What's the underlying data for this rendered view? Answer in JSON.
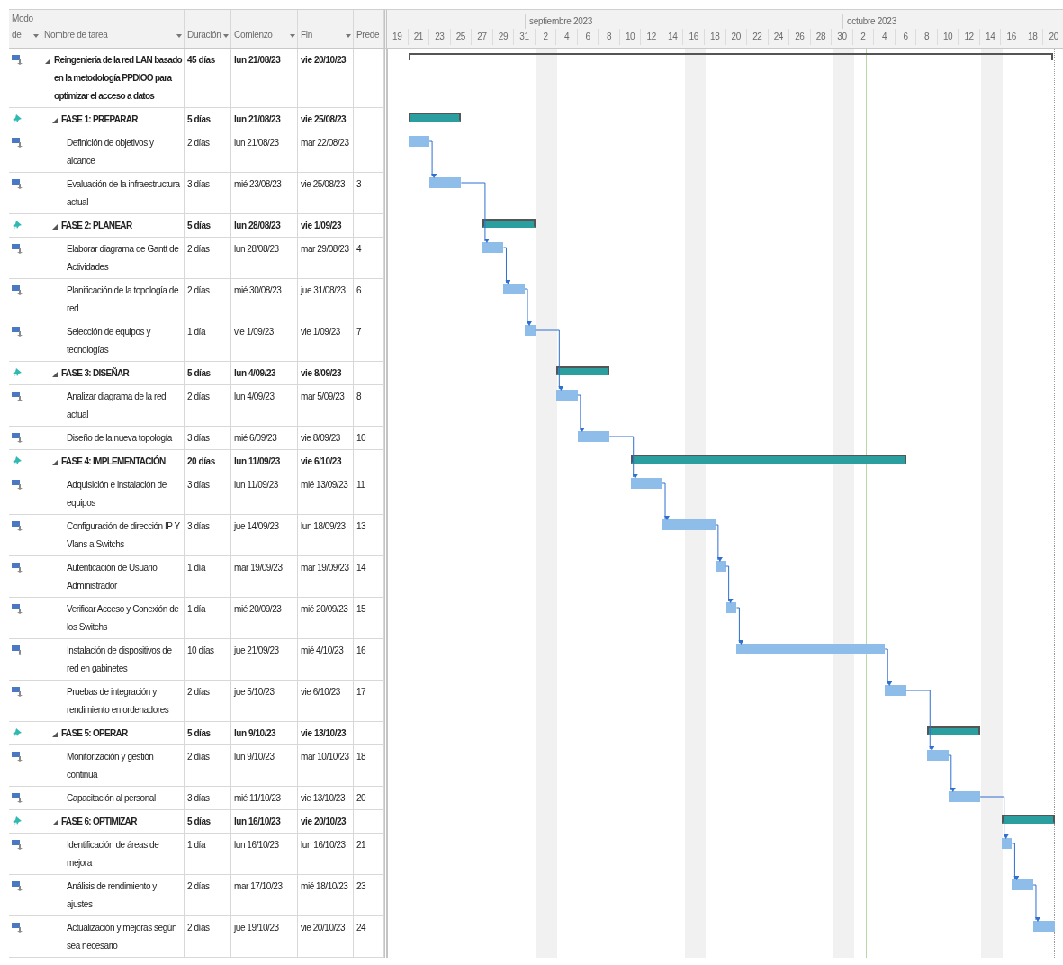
{
  "header": {
    "columns": [
      {
        "label": "Modo de",
        "filter": true
      },
      {
        "label": "Nombre de tarea",
        "filter": true
      },
      {
        "label": "Duración",
        "filter": true
      },
      {
        "label": "Comienzo",
        "filter": true
      },
      {
        "label": "Fin",
        "filter": true
      },
      {
        "label": "Prede",
        "filter": false
      }
    ]
  },
  "timeline": {
    "months": [
      "septiembre 2023",
      "octubre 2023"
    ],
    "days": [
      "19",
      "21",
      "23",
      "25",
      "27",
      "29",
      "31",
      "2",
      "4",
      "6",
      "8",
      "10",
      "12",
      "14",
      "16",
      "18",
      "20",
      "22",
      "24",
      "26",
      "28",
      "30",
      "2",
      "4",
      "6",
      "8",
      "10",
      "12",
      "14",
      "16",
      "18",
      "20"
    ]
  },
  "project": {
    "kind": "project",
    "name": "Reingeniería de la red LAN basado en la metodología PPDIOO para optimizar el acceso a datos",
    "duration": "45 días",
    "start": "lun 21/08/23",
    "end": "vie 20/10/23",
    "expanded": true,
    "children": [
      {
        "kind": "phase",
        "name": "FASE 1: PREPARAR",
        "duration": "5 días",
        "start": "lun 21/08/23",
        "end": "vie 25/08/23",
        "expanded": true,
        "children": [
          {
            "kind": "task",
            "name": "Definición de objetivos y alcance",
            "duration": "2 días",
            "start": "lun 21/08/23",
            "end": "mar 22/08/23"
          },
          {
            "kind": "task",
            "name": "Evaluación de la infraestructura actual",
            "duration": "3 días",
            "start": "mié 23/08/23",
            "end": "vie 25/08/23",
            "predecessor": "3"
          }
        ]
      },
      {
        "kind": "phase",
        "name": "FASE 2: PLANEAR",
        "duration": "5 días",
        "start": "lun 28/08/23",
        "end": "vie 1/09/23",
        "expanded": true,
        "children": [
          {
            "kind": "task",
            "name": "Elaborar diagrama de Gantt de Actividades",
            "duration": "2 días",
            "start": "lun 28/08/23",
            "end": "mar 29/08/23",
            "predecessor": "4"
          },
          {
            "kind": "task",
            "name": "Planificación de la topología de red",
            "duration": "2 días",
            "start": "mié 30/08/23",
            "end": "jue 31/08/23",
            "predecessor": "6"
          },
          {
            "kind": "task",
            "name": "Selección de equipos y tecnologías",
            "duration": "1 día",
            "start": "vie 1/09/23",
            "end": "vie 1/09/23",
            "predecessor": "7"
          }
        ]
      },
      {
        "kind": "phase",
        "name": "FASE 3: DISEÑAR",
        "duration": "5 días",
        "start": "lun 4/09/23",
        "end": "vie 8/09/23",
        "expanded": true,
        "children": [
          {
            "kind": "task",
            "name": "Analizar diagrama de la red actual",
            "duration": "2 días",
            "start": "lun 4/09/23",
            "end": "mar 5/09/23",
            "predecessor": "8"
          },
          {
            "kind": "task",
            "name": "Diseño de la nueva topología",
            "duration": "3 días",
            "start": "mié 6/09/23",
            "end": "vie 8/09/23",
            "predecessor": "10"
          }
        ]
      },
      {
        "kind": "phase",
        "name": "FASE 4: IMPLEMENTACIÓN",
        "duration": "20 días",
        "start": "lun 11/09/23",
        "end": "vie 6/10/23",
        "expanded": true,
        "children": [
          {
            "kind": "task",
            "name": "Adquisición e instalación de equipos",
            "duration": "3 días",
            "start": "lun 11/09/23",
            "end": "mié 13/09/23",
            "predecessor": "11"
          },
          {
            "kind": "task",
            "name": "Configuración de dirección IP Y Vlans a Switchs",
            "duration": "3 días",
            "start": "jue 14/09/23",
            "end": "lun 18/09/23",
            "predecessor": "13"
          },
          {
            "kind": "task",
            "name": "Autenticación de Usuario Administrador",
            "duration": "1 día",
            "start": "mar 19/09/23",
            "end": "mar 19/09/23",
            "predecessor": "14"
          },
          {
            "kind": "task",
            "name": "Verificar Acceso y Conexión de los Switchs",
            "duration": "1 día",
            "start": "mié 20/09/23",
            "end": "mié 20/09/23",
            "predecessor": "15"
          },
          {
            "kind": "task",
            "name": "Instalación de dispositivos de red en gabinetes",
            "duration": "10 días",
            "start": "jue 21/09/23",
            "end": "mié 4/10/23",
            "predecessor": "16"
          },
          {
            "kind": "task",
            "name": "Pruebas de integración y rendimiento en ordenadores",
            "duration": "2 días",
            "start": "jue 5/10/23",
            "end": "vie 6/10/23",
            "predecessor": "17"
          }
        ]
      },
      {
        "kind": "phase",
        "name": "FASE 5: OPERAR",
        "duration": "5 días",
        "start": "lun 9/10/23",
        "end": "vie 13/10/23",
        "expanded": true,
        "children": [
          {
            "kind": "task",
            "name": "Monitorización y gestión continua",
            "duration": "2 días",
            "start": "lun 9/10/23",
            "end": "mar 10/10/23",
            "predecessor": "18"
          },
          {
            "kind": "task",
            "name": "Capacitación al personal",
            "duration": "3 días",
            "start": "mié 11/10/23",
            "end": "vie 13/10/23",
            "predecessor": "20"
          }
        ]
      },
      {
        "kind": "phase",
        "name": "FASE 6: OPTIMIZAR",
        "duration": "5 días",
        "start": "lun 16/10/23",
        "end": "vie 20/10/23",
        "expanded": true,
        "children": [
          {
            "kind": "task",
            "name": "Identificación de áreas de mejora",
            "duration": "1 día",
            "start": "lun 16/10/23",
            "end": "lun 16/10/23",
            "predecessor": "21"
          },
          {
            "kind": "task",
            "name": "Análisis de rendimiento y ajustes",
            "duration": "2 días",
            "start": "mar 17/10/23",
            "end": "mié 18/10/23",
            "predecessor": "23"
          },
          {
            "kind": "task",
            "name": "Actualización y mejoras según sea necesario",
            "duration": "2 días",
            "start": "jue 19/10/23",
            "end": "vie 20/10/23",
            "predecessor": "24"
          }
        ]
      }
    ]
  }
}
